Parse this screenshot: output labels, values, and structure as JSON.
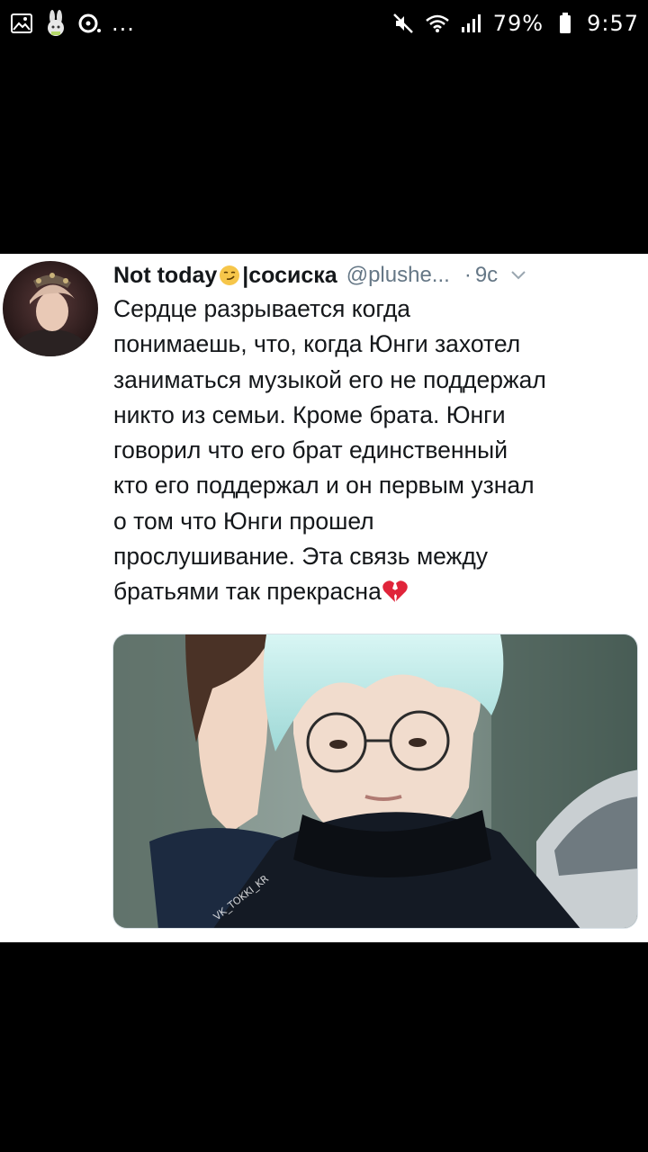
{
  "status_bar": {
    "left_icons": [
      "image-icon",
      "bunny-app-icon",
      "music-disc-icon",
      "more-notifications-icon"
    ],
    "more_text": "...",
    "battery": "79%",
    "time": "9:57"
  },
  "tweet": {
    "author_name": "Not today",
    "author_name_suffix": "|сосиска",
    "handle": "@plushe...",
    "separator": "·",
    "time_ago": "9с",
    "lines": [
      "Сердце разрывается когда",
      "понимаешь, что, когда Юнги захотел",
      "заниматься музыкой его не поддержал",
      "никто из семьи. Кроме брата. Юнги",
      "говорил что его брат единственный",
      "кто его поддержал и он первым узнал",
      "о том что Юнги прошел",
      "прослушивание. Эта связь между",
      "братьями так прекрасна"
    ],
    "watermark": "VK_TOKKI_KR"
  },
  "colors": {
    "text_primary": "#14171a",
    "text_secondary": "#657786",
    "background": "#ffffff",
    "letterbox": "#000000"
  }
}
